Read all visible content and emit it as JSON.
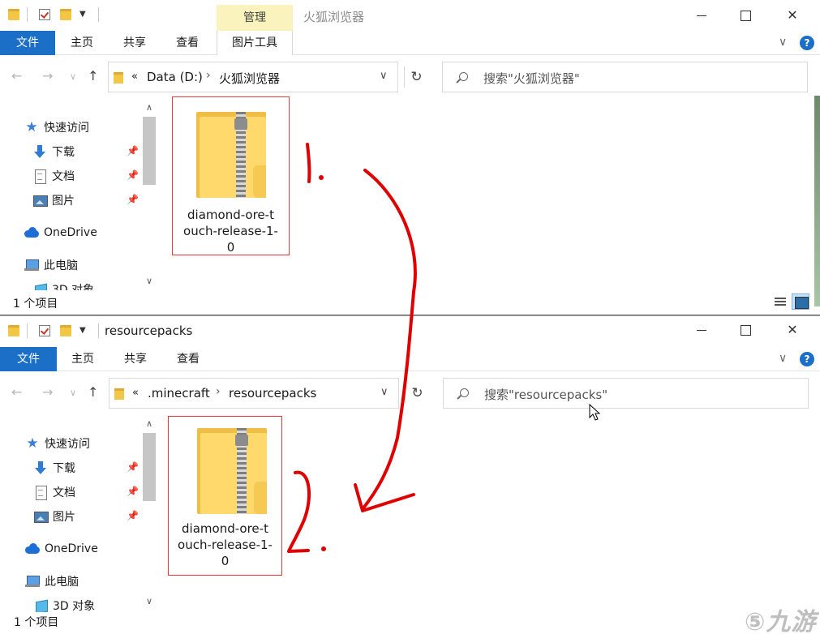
{
  "window1": {
    "title": "火狐浏览器",
    "manage_tab": "管理",
    "tabs": [
      "文件",
      "主页",
      "共享",
      "查看",
      "图片工具"
    ],
    "breadcrumb": [
      "«",
      "Data (D:)",
      "火狐浏览器"
    ],
    "search_placeholder": "搜索\"火狐浏览器\"",
    "sidebar": [
      {
        "label": "快速访问",
        "icon": "star-icon"
      },
      {
        "label": "下载",
        "icon": "download-icon",
        "pinned": true
      },
      {
        "label": "文档",
        "icon": "document-icon",
        "pinned": true
      },
      {
        "label": "图片",
        "icon": "pictures-icon",
        "pinned": true
      },
      {
        "label": "OneDrive",
        "icon": "cloud-icon"
      },
      {
        "label": "此电脑",
        "icon": "computer-icon"
      },
      {
        "label": "3D 对象",
        "icon": "cube-icon"
      }
    ],
    "file": {
      "line1": "diamond-ore-t",
      "line2": "ouch-release-1-",
      "line3": "0"
    },
    "status": "1 个项目"
  },
  "window2": {
    "title": "resourcepacks",
    "tabs": [
      "文件",
      "主页",
      "共享",
      "查看"
    ],
    "breadcrumb": [
      "«",
      ".minecraft",
      "resourcepacks"
    ],
    "search_placeholder": "搜索\"resourcepacks\"",
    "sidebar": [
      {
        "label": "快速访问",
        "icon": "star-icon"
      },
      {
        "label": "下载",
        "icon": "download-icon",
        "pinned": true
      },
      {
        "label": "文档",
        "icon": "document-icon",
        "pinned": true
      },
      {
        "label": "图片",
        "icon": "pictures-icon",
        "pinned": true
      },
      {
        "label": "OneDrive",
        "icon": "cloud-icon"
      },
      {
        "label": "此电脑",
        "icon": "computer-icon"
      },
      {
        "label": "3D 对象",
        "icon": "cube-icon"
      }
    ],
    "file": {
      "line1": "diamond-ore-t",
      "line2": "ouch-release-1-",
      "line3": "0"
    },
    "status": "1 个项目"
  },
  "annotations": {
    "step1": "1.",
    "step2": "2.",
    "color": "#e00000"
  },
  "watermark": "九游",
  "colors": {
    "accent": "#1b6fc6",
    "manage_tab": "#fbf3bd",
    "highlight_box": "#e53935"
  }
}
